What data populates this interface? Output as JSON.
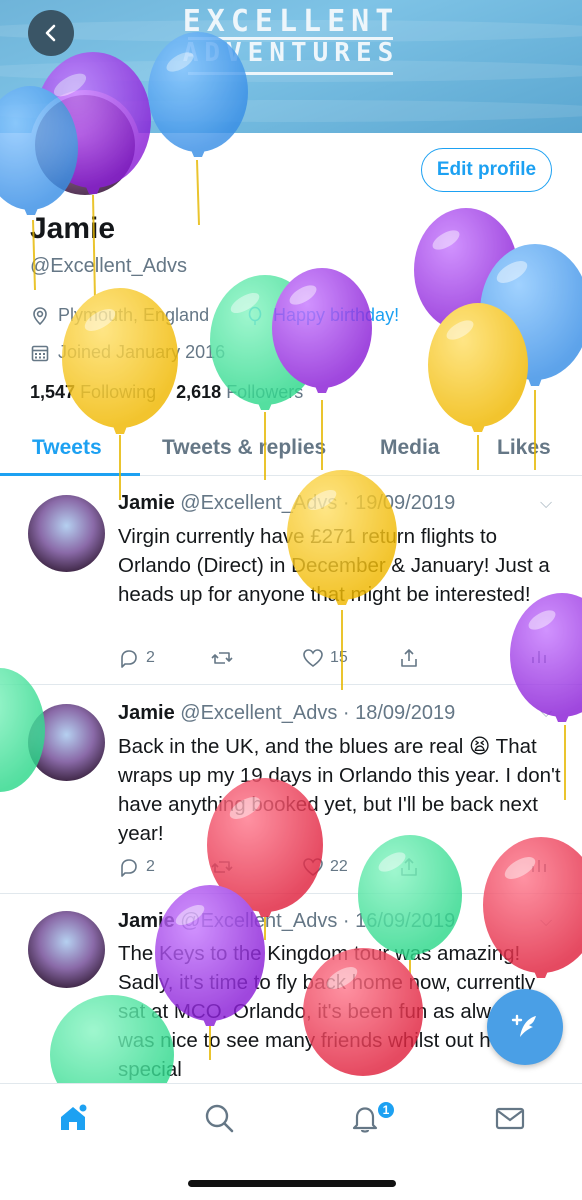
{
  "banner": {
    "line1": "EXCELLENT",
    "line2": "ADVENTURES"
  },
  "profile": {
    "edit_label": "Edit profile",
    "name": "Jamie",
    "handle": "@Excellent_Advs",
    "location": "Plymouth, England",
    "birthday": "Happy birthday!",
    "joined": "Joined January 2016",
    "following_count": "1,547",
    "following_label": "Following",
    "followers_count": "2,618",
    "followers_label": "Followers"
  },
  "tabs": [
    {
      "label": "Tweets"
    },
    {
      "label": "Tweets & replies"
    },
    {
      "label": "Media"
    },
    {
      "label": "Likes"
    }
  ],
  "tweets": [
    {
      "name": "Jamie",
      "handle": "@Excellent_Advs",
      "date": "· 19/09/2019",
      "text": "Virgin currently have £271 return flights to Orlando (Direct) in December & January! Just a heads up for anyone that might be interested!",
      "replies": "2",
      "likes": "15"
    },
    {
      "name": "Jamie",
      "handle": "@Excellent_Advs",
      "date": "· 18/09/2019",
      "text": "Back in the UK, and the blues are real 😫 That wraps up my 19 days in Orlando this year. I don't have anything booked yet, but I'll be back next year!",
      "replies": "2",
      "likes": "22"
    },
    {
      "name": "Jamie",
      "handle": "@Excellent_Advs",
      "date": "· 16/09/2019",
      "text": "The Keys to the Kingdom tour was amazing! Sadly, it's time to fly back home now, currently sat at MCO. Orlando, it's been fun as always - It was nice to see many friends whilst out here. A special",
      "replies": "",
      "likes": ""
    }
  ],
  "nav": {
    "notification_count": "1"
  },
  "colors": {
    "accent": "#1da1f2",
    "balloon_purple": "#9b30e0",
    "balloon_blue": "#4aa3f0",
    "balloon_yellow": "#f5c518",
    "balloon_green": "#52e0a0",
    "balloon_red": "#f0405a"
  }
}
